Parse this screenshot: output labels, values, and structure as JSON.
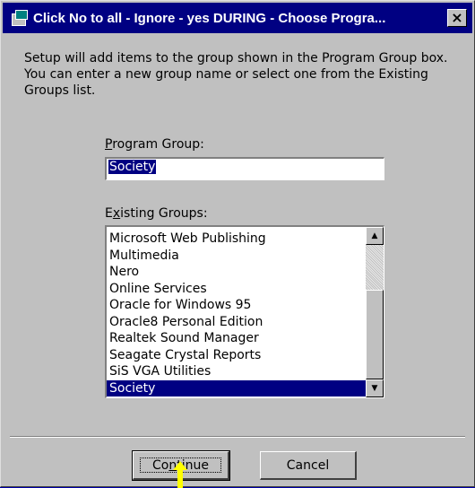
{
  "window": {
    "title": "Click No to all - Ignore - yes DURING - Choose Progra...",
    "close_label": "×"
  },
  "description": "Setup will add items to the group shown in the Program Group box. You can enter a new group name or select one from the Existing Groups list.",
  "program_group": {
    "label_pre": "",
    "label_accel": "P",
    "label_post": "rogram Group:",
    "value": "Society"
  },
  "existing_groups": {
    "label_pre": "E",
    "label_accel": "x",
    "label_post": "isting Groups:",
    "items": [
      "Microsoft Web Publishing",
      "Multimedia",
      "Nero",
      "Online Services",
      "Oracle for Windows 95",
      "Oracle8 Personal Edition",
      "Realtek Sound Manager",
      "Seagate Crystal Reports",
      "SiS VGA Utilities",
      "Society"
    ],
    "selected": "Society",
    "scroll_up_icon": "▲",
    "scroll_down_icon": "▼"
  },
  "buttons": {
    "continue_pre": "Co",
    "continue_accel": "n",
    "continue_post": "tinue",
    "cancel": "Cancel"
  },
  "colors": {
    "selection": "#000082",
    "face": "#c0c0c0",
    "pointer": "#ffff00"
  }
}
